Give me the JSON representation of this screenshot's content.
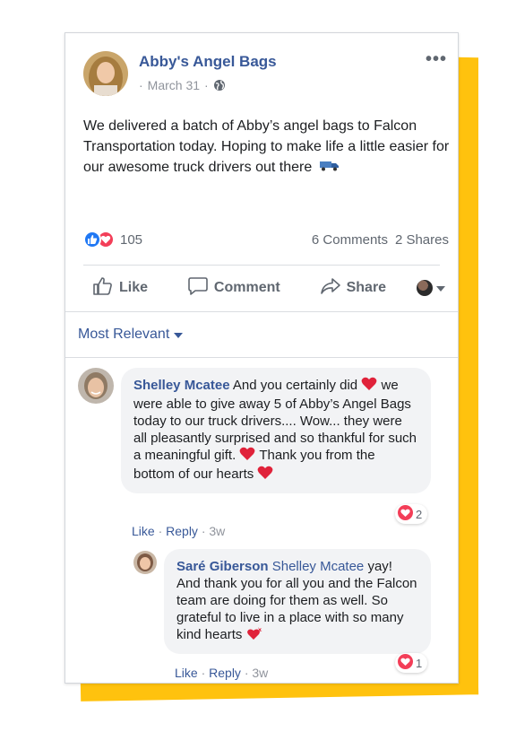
{
  "post": {
    "page_name": "Abby's Angel Bags",
    "date": "March 31",
    "meta_sep": "·",
    "text": "We delivered a batch of Abby’s angel bags to Falcon Transportation today. Hoping to make life a little easier for our awesome truck drivers out there",
    "reaction_count": "105",
    "comments_count": "6 Comments",
    "shares_count": "2 Shares",
    "more_label": "•••"
  },
  "actions": {
    "like": "Like",
    "comment": "Comment",
    "share": "Share"
  },
  "comments_filter": "Most Relevant",
  "comments": [
    {
      "author": "Shelley Mcatee",
      "text_1": "And you certainly did",
      "text_2": "we were able to give away 5 of Abby’s Angel Bags today to our truck drivers.... Wow... they were all pleasantly surprised and so thankful for such a meaningful gift.",
      "text_3": "Thank you from the bottom of our hearts",
      "reaction_count": "2",
      "like_label": "Like",
      "reply_label": "Reply",
      "time": "3w"
    },
    {
      "author": "Saré Giberson",
      "tag": "Shelley Mcatee",
      "text": "yay! And thank you for all you and the Falcon team are doing for them as well. So grateful to live in a place with so many kind hearts",
      "reaction_count": "1",
      "like_label": "Like",
      "reply_label": "Reply",
      "time": "3w"
    }
  ],
  "colors": {
    "accent": "#ffc20e",
    "link": "#385898",
    "like_blue": "#2078f4",
    "love_red": "#f33e58"
  },
  "icons": [
    "globe-icon",
    "more-icon",
    "like-reaction-icon",
    "love-reaction-icon",
    "thumbs-up-icon",
    "comment-icon",
    "share-icon",
    "caret-down-icon",
    "truck-icon",
    "heart-icon"
  ]
}
